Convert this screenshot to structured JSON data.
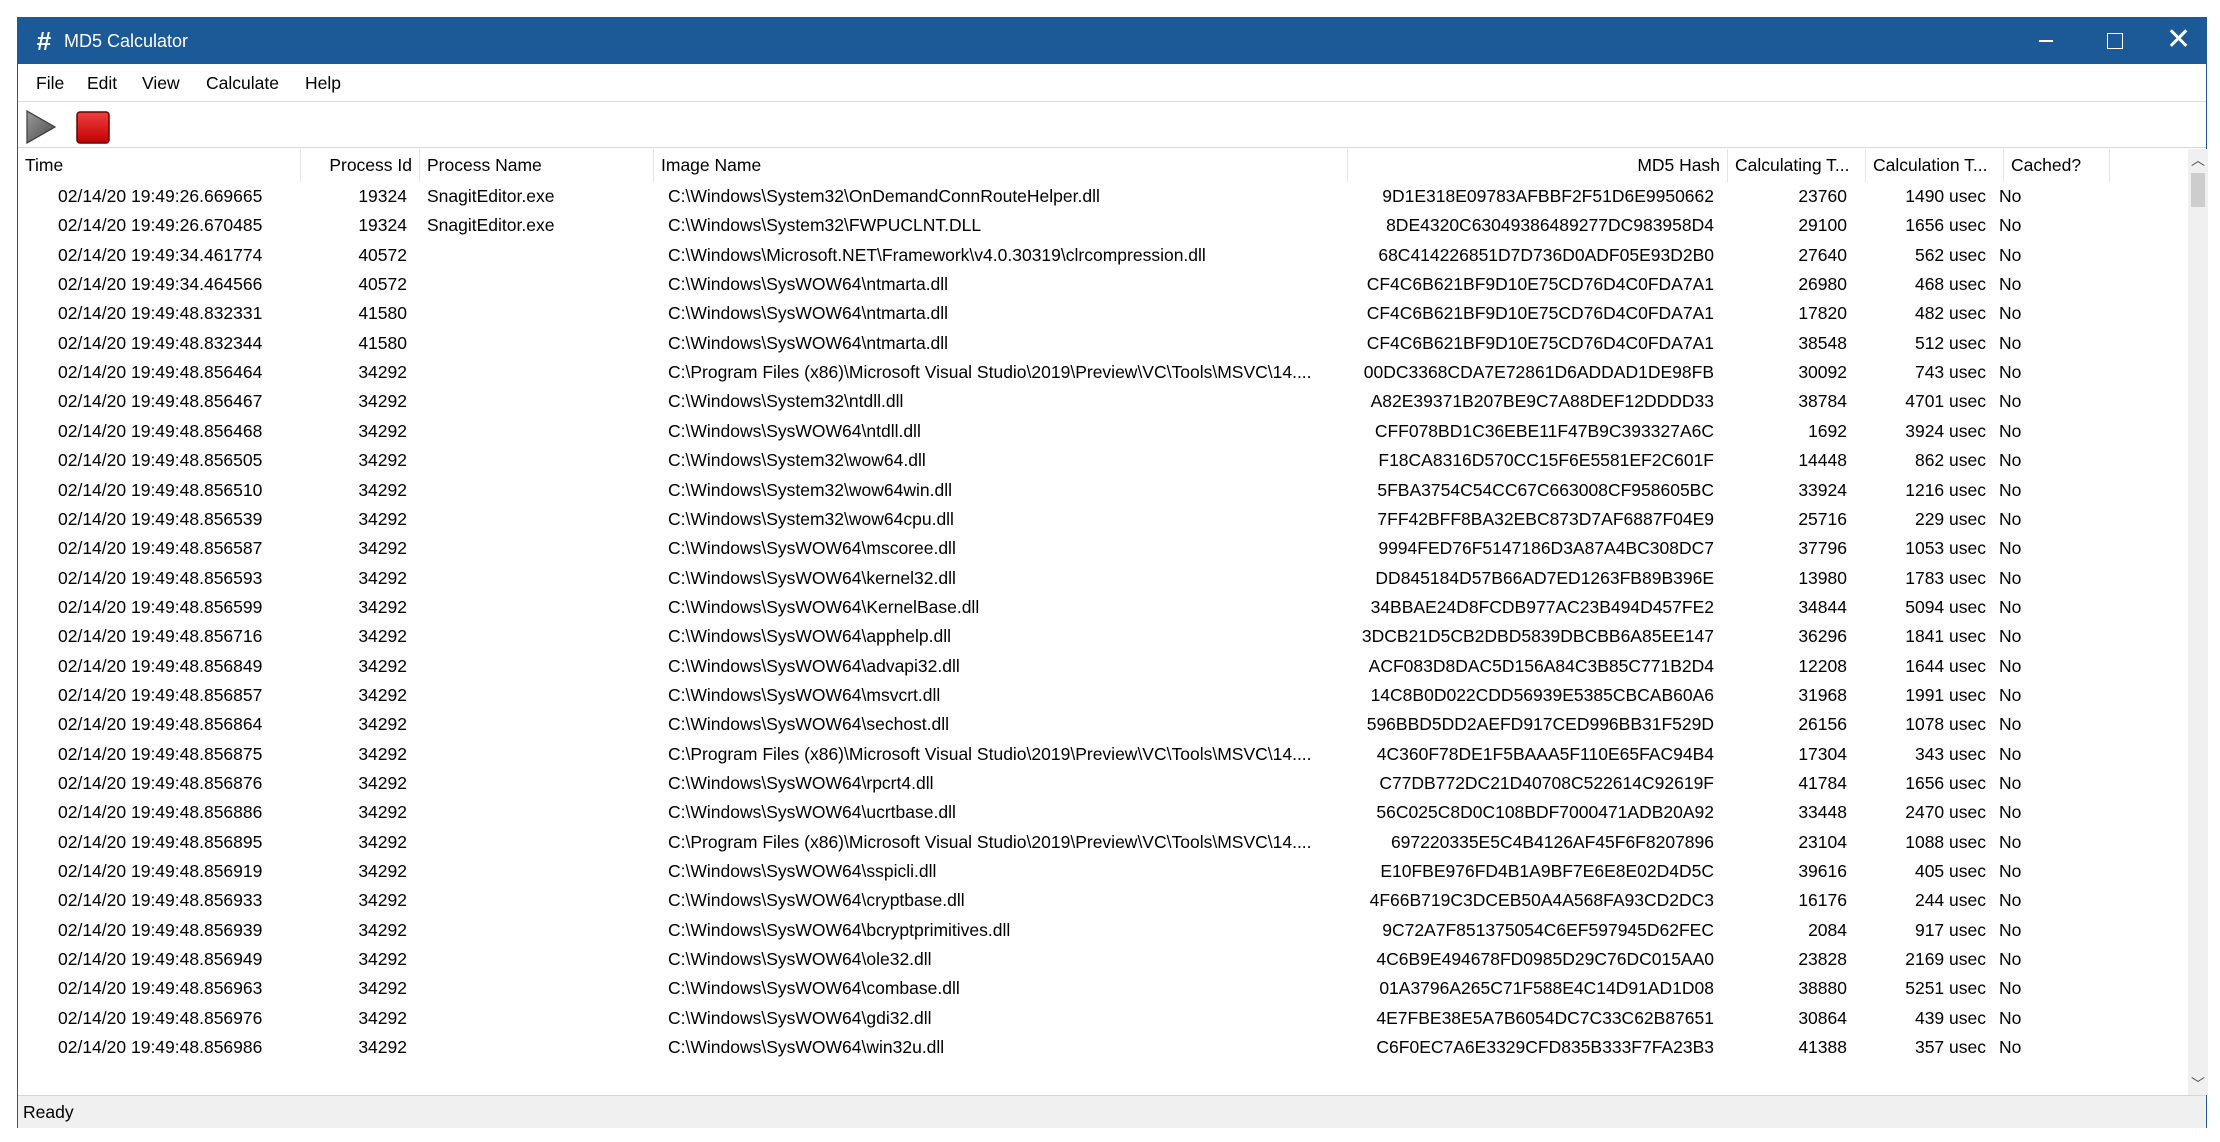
{
  "window": {
    "title": "MD5 Calculator",
    "icon": "hash-icon",
    "accent": "#1b5a96"
  },
  "menu": [
    "File",
    "Edit",
    "View",
    "Calculate",
    "Help"
  ],
  "toolbar": {
    "play_icon": "play-icon",
    "stop_icon": "stop-icon",
    "stop_color": "#e0131b"
  },
  "columns": [
    "Time",
    "Process Id",
    "Process Name",
    "Image Name",
    "MD5 Hash",
    "Calculating T...",
    "Calculation T...",
    "Cached?"
  ],
  "rows": [
    [
      "02/14/20 19:49:26.669665",
      "19324",
      "SnagitEditor.exe",
      "C:\\Windows\\System32\\OnDemandConnRouteHelper.dll",
      "9D1E318E09783AFBBF2F51D6E9950662",
      "23760",
      "1490 usec",
      "No"
    ],
    [
      "02/14/20 19:49:26.670485",
      "19324",
      "SnagitEditor.exe",
      "C:\\Windows\\System32\\FWPUCLNT.DLL",
      "8DE4320C63049386489277DC983958D4",
      "29100",
      "1656 usec",
      "No"
    ],
    [
      "02/14/20 19:49:34.461774",
      "40572",
      "",
      "C:\\Windows\\Microsoft.NET\\Framework\\v4.0.30319\\clrcompression.dll",
      "68C414226851D7D736D0ADF05E93D2B0",
      "27640",
      "562 usec",
      "No"
    ],
    [
      "02/14/20 19:49:34.464566",
      "40572",
      "",
      "C:\\Windows\\SysWOW64\\ntmarta.dll",
      "CF4C6B621BF9D10E75CD76D4C0FDA7A1",
      "26980",
      "468 usec",
      "No"
    ],
    [
      "02/14/20 19:49:48.832331",
      "41580",
      "",
      "C:\\Windows\\SysWOW64\\ntmarta.dll",
      "CF4C6B621BF9D10E75CD76D4C0FDA7A1",
      "17820",
      "482 usec",
      "No"
    ],
    [
      "02/14/20 19:49:48.832344",
      "41580",
      "",
      "C:\\Windows\\SysWOW64\\ntmarta.dll",
      "CF4C6B621BF9D10E75CD76D4C0FDA7A1",
      "38548",
      "512 usec",
      "No"
    ],
    [
      "02/14/20 19:49:48.856464",
      "34292",
      "",
      "C:\\Program Files (x86)\\Microsoft Visual Studio\\2019\\Preview\\VC\\Tools\\MSVC\\14....",
      "00DC3368CDA7E72861D6ADDAD1DE98FB",
      "30092",
      "743 usec",
      "No"
    ],
    [
      "02/14/20 19:49:48.856467",
      "34292",
      "",
      "C:\\Windows\\System32\\ntdll.dll",
      "A82E39371B207BE9C7A88DEF12DDDD33",
      "38784",
      "4701 usec",
      "No"
    ],
    [
      "02/14/20 19:49:48.856468",
      "34292",
      "",
      "C:\\Windows\\SysWOW64\\ntdll.dll",
      "CFF078BD1C36EBE11F47B9C393327A6C",
      "1692",
      "3924 usec",
      "No"
    ],
    [
      "02/14/20 19:49:48.856505",
      "34292",
      "",
      "C:\\Windows\\System32\\wow64.dll",
      "F18CA8316D570CC15F6E5581EF2C601F",
      "14448",
      "862 usec",
      "No"
    ],
    [
      "02/14/20 19:49:48.856510",
      "34292",
      "",
      "C:\\Windows\\System32\\wow64win.dll",
      "5FBA3754C54CC67C663008CF958605BC",
      "33924",
      "1216 usec",
      "No"
    ],
    [
      "02/14/20 19:49:48.856539",
      "34292",
      "",
      "C:\\Windows\\System32\\wow64cpu.dll",
      "7FF42BFF8BA32EBC873D7AF6887F04E9",
      "25716",
      "229 usec",
      "No"
    ],
    [
      "02/14/20 19:49:48.856587",
      "34292",
      "",
      "C:\\Windows\\SysWOW64\\mscoree.dll",
      "9994FED76F5147186D3A87A4BC308DC7",
      "37796",
      "1053 usec",
      "No"
    ],
    [
      "02/14/20 19:49:48.856593",
      "34292",
      "",
      "C:\\Windows\\SysWOW64\\kernel32.dll",
      "DD845184D57B66AD7ED1263FB89B396E",
      "13980",
      "1783 usec",
      "No"
    ],
    [
      "02/14/20 19:49:48.856599",
      "34292",
      "",
      "C:\\Windows\\SysWOW64\\KernelBase.dll",
      "34BBAE24D8FCDB977AC23B494D457FE2",
      "34844",
      "5094 usec",
      "No"
    ],
    [
      "02/14/20 19:49:48.856716",
      "34292",
      "",
      "C:\\Windows\\SysWOW64\\apphelp.dll",
      "3DCB21D5CB2DBD5839DBCBB6A85EE147",
      "36296",
      "1841 usec",
      "No"
    ],
    [
      "02/14/20 19:49:48.856849",
      "34292",
      "",
      "C:\\Windows\\SysWOW64\\advapi32.dll",
      "ACF083D8DAC5D156A84C3B85C771B2D4",
      "12208",
      "1644 usec",
      "No"
    ],
    [
      "02/14/20 19:49:48.856857",
      "34292",
      "",
      "C:\\Windows\\SysWOW64\\msvcrt.dll",
      "14C8B0D022CDD56939E5385CBCAB60A6",
      "31968",
      "1991 usec",
      "No"
    ],
    [
      "02/14/20 19:49:48.856864",
      "34292",
      "",
      "C:\\Windows\\SysWOW64\\sechost.dll",
      "596BBD5DD2AEFD917CED996BB31F529D",
      "26156",
      "1078 usec",
      "No"
    ],
    [
      "02/14/20 19:49:48.856875",
      "34292",
      "",
      "C:\\Program Files (x86)\\Microsoft Visual Studio\\2019\\Preview\\VC\\Tools\\MSVC\\14....",
      "4C360F78DE1F5BAAA5F110E65FAC94B4",
      "17304",
      "343 usec",
      "No"
    ],
    [
      "02/14/20 19:49:48.856876",
      "34292",
      "",
      "C:\\Windows\\SysWOW64\\rpcrt4.dll",
      "C77DB772DC21D40708C522614C92619F",
      "41784",
      "1656 usec",
      "No"
    ],
    [
      "02/14/20 19:49:48.856886",
      "34292",
      "",
      "C:\\Windows\\SysWOW64\\ucrtbase.dll",
      "56C025C8D0C108BDF7000471ADB20A92",
      "33448",
      "2470 usec",
      "No"
    ],
    [
      "02/14/20 19:49:48.856895",
      "34292",
      "",
      "C:\\Program Files (x86)\\Microsoft Visual Studio\\2019\\Preview\\VC\\Tools\\MSVC\\14....",
      "697220335E5C4B4126AF45F6F8207896",
      "23104",
      "1088 usec",
      "No"
    ],
    [
      "02/14/20 19:49:48.856919",
      "34292",
      "",
      "C:\\Windows\\SysWOW64\\sspicli.dll",
      "E10FBE976FD4B1A9BF7E6E8E02D4D5C",
      "39616",
      "405 usec",
      "No"
    ],
    [
      "02/14/20 19:49:48.856933",
      "34292",
      "",
      "C:\\Windows\\SysWOW64\\cryptbase.dll",
      "4F66B719C3DCEB50A4A568FA93CD2DC3",
      "16176",
      "244 usec",
      "No"
    ],
    [
      "02/14/20 19:49:48.856939",
      "34292",
      "",
      "C:\\Windows\\SysWOW64\\bcryptprimitives.dll",
      "9C72A7F851375054C6EF597945D62FEC",
      "2084",
      "917 usec",
      "No"
    ],
    [
      "02/14/20 19:49:48.856949",
      "34292",
      "",
      "C:\\Windows\\SysWOW64\\ole32.dll",
      "4C6B9E494678FD0985D29C76DC015AA0",
      "23828",
      "2169 usec",
      "No"
    ],
    [
      "02/14/20 19:49:48.856963",
      "34292",
      "",
      "C:\\Windows\\SysWOW64\\combase.dll",
      "01A3796A265C71F588E4C14D91AD1D08",
      "38880",
      "5251 usec",
      "No"
    ],
    [
      "02/14/20 19:49:48.856976",
      "34292",
      "",
      "C:\\Windows\\SysWOW64\\gdi32.dll",
      "4E7FBE38E5A7B6054DC7C33C62B87651",
      "30864",
      "439 usec",
      "No"
    ],
    [
      "02/14/20 19:49:48.856986",
      "34292",
      "",
      "C:\\Windows\\SysWOW64\\win32u.dll",
      "C6F0EC7A6E3329CFD835B333F7FA23B3",
      "41388",
      "357 usec",
      "No"
    ]
  ],
  "status": "Ready"
}
